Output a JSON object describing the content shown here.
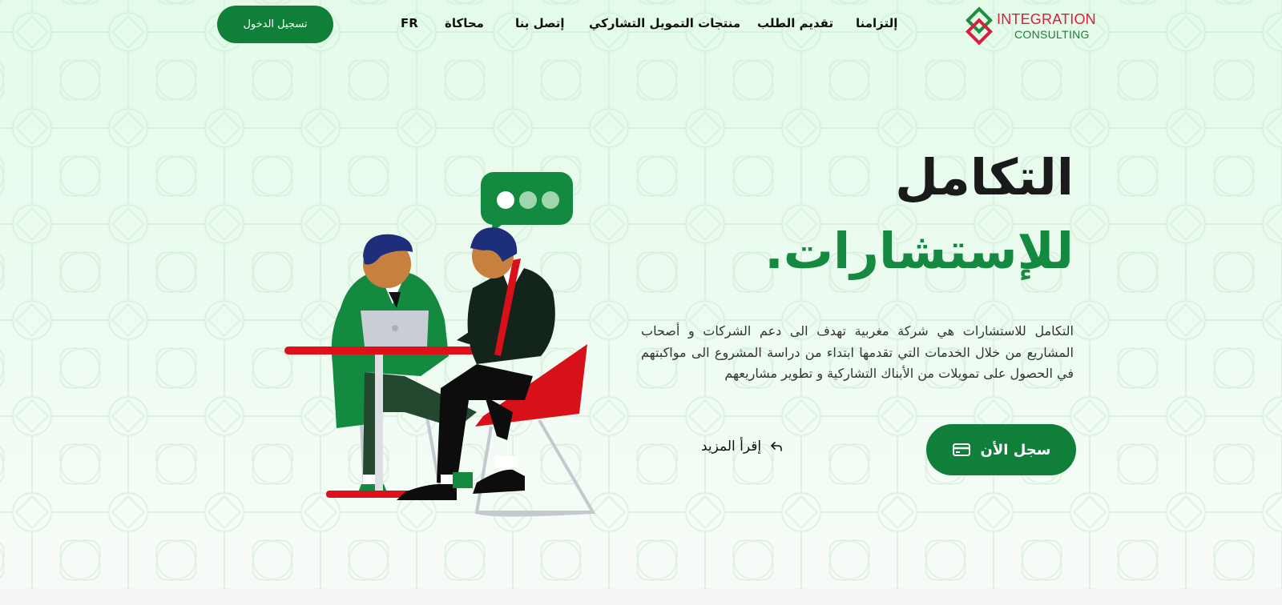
{
  "header": {
    "login_label": "تسجيل الدخول",
    "nav": {
      "fr": "FR",
      "simulation": "محاكاة",
      "contact": "إتصل بنا",
      "products": "منتجات التمويل التشاركي",
      "apply": "تقديم الطلب",
      "commitment": "إلتزامنا"
    },
    "logo": {
      "line1": "INTEGRATION",
      "line2": "CONSULTING"
    }
  },
  "hero": {
    "title_line1": "التكامل",
    "title_line2": "للإستشارات.",
    "description": "التكامل للاستشارات هي شركة مغربية تهدف الى دعم الشركات و أصحاب المشاريع من خلال الخدمات التي تقدمها ابتداء من دراسة المشروع الى مواكبتهم في الحصول على تمويلات من الأبناك التشاركية و تطوير مشاريعهم",
    "cta_label": "سجل الأن",
    "cta_icon": "credit-card-icon",
    "more_label": "إقرأ المزيد",
    "more_icon": "reply-arrow-icon"
  },
  "colors": {
    "brand_green": "#0f7f3a",
    "title_green": "#138a3f",
    "logo_red": "#d4213d",
    "chair_red": "#d8101a",
    "background_tint": "#e6fbeb"
  }
}
